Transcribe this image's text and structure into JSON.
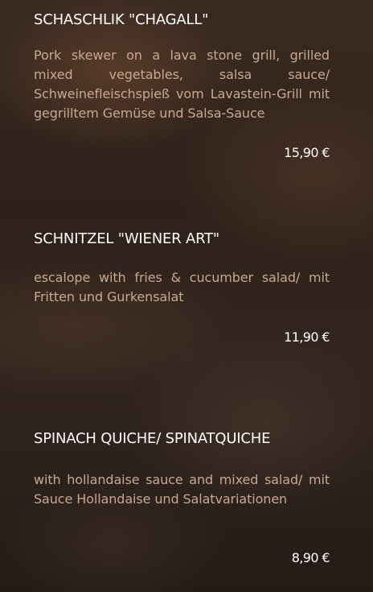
{
  "menu": {
    "items": [
      {
        "title": "SCHASCHLIK \"CHAGALL\"",
        "description": "Pork skewer on a lava stone grill, grilled mixed vegetables, salsa sauce/ Schweinefleischspieß vom Lavastein-Grill mit gegrilltem Gemüse und Salsa-Sauce",
        "price": "15,90 €"
      },
      {
        "title": "SCHNITZEL \"WIENER ART\"",
        "description": "escalope with fries & cucumber salad/ mit Fritten und Gurkensalat",
        "price": "11,90 €"
      },
      {
        "title": "SPINACH QUICHE/ SPINATQUICHE",
        "description": "with hollandaise sauce and mixed salad/ mit Sauce Hollandaise und Salatvariationen",
        "price": "8,90 €"
      }
    ]
  }
}
